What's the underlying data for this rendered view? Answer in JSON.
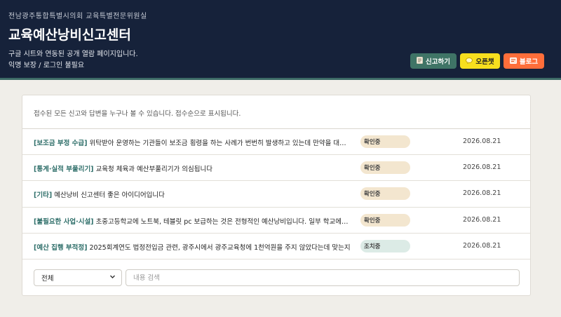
{
  "header": {
    "org": "전남광주통합특별시의회 교육특별전문위원실",
    "title": "교육예산낭비신고센터",
    "desc_line1": "구글 시트와 연동된 공개 열람 페이지입니다.",
    "desc_line2": "익명 보장 / 로그인 불필요",
    "buttons": {
      "report": {
        "label": "신고하기",
        "icon": "document-icon"
      },
      "chat": {
        "label": "오픈챗",
        "icon": "chat-bubble-icon"
      },
      "blog": {
        "label": "블로그",
        "icon": "blog-icon"
      }
    }
  },
  "main": {
    "notice": "접수된 모든 신고와 답변을 누구나 볼 수 있습니다. 접수순으로 표시됩니다.",
    "reports": [
      {
        "category": "[보조금 부정 수급]",
        "text": "위탁받아 운영하는 기관들이 보조금 횡령을 하는 사례가 번번히 발생하고 있는데 만약을 대비하여",
        "status": "확인중",
        "date": "2026.08.21"
      },
      {
        "category": "[통계·실적 부풀리기]",
        "text": "교육청 체육과 예산부풀리기가 의심됩니다",
        "status": "확인중",
        "date": "2026.08.21"
      },
      {
        "category": "[기타]",
        "text": "예산낭비 신고센터 좋은 아이디어입니다",
        "status": "확인중",
        "date": "2026.08.21"
      },
      {
        "category": "[불필요한 사업·시설]",
        "text": "초중고등학교에 노트북, 테블릿 pc 보급하는 것은 전형적인 예산낭비입니다. 일부 학교에서는",
        "status": "확인중",
        "date": "2026.08.21"
      },
      {
        "category": "[예산 집행 부적정]",
        "text": "2025회계연도 법정전입금 관련, 광주시에서 광주교육청에 1천억원을 주지 않았다는데 맞는지",
        "status": "조치중",
        "date": "2026.08.21"
      }
    ],
    "filter": {
      "selected": "전체",
      "icon": "chevron-down-icon"
    },
    "search": {
      "placeholder": "내용 검색",
      "value": ""
    }
  },
  "colors": {
    "header_bg": "#16223a",
    "accent_teal": "#3f7466",
    "chat_yellow": "#f7df1e",
    "blog_orange": "#ff6e3a",
    "status_checking": "#f3e6cf",
    "status_action": "#dcebe6"
  }
}
